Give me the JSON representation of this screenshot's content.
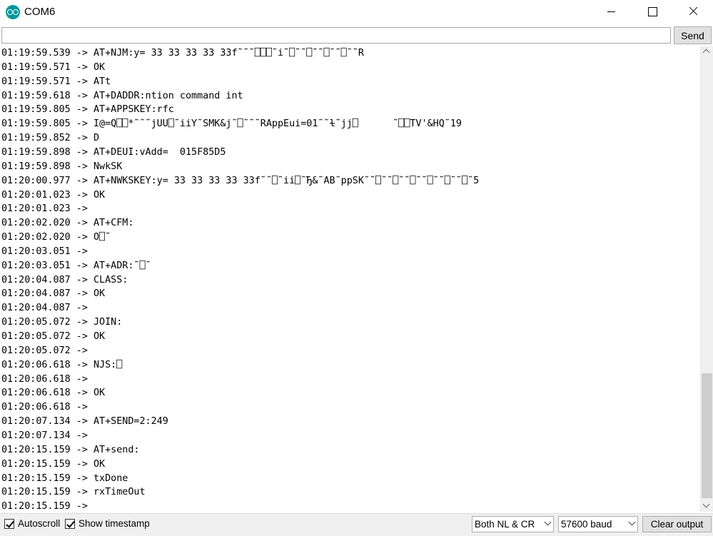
{
  "window": {
    "title": "COM6"
  },
  "toolbar": {
    "input_value": "",
    "send_label": "Send"
  },
  "output_lines": [
    "01:19:59.539 -> AT+NJM:y= 33 33 33 33 33f˜˜˜⎕⎕⎕˜i˜⎕˜˜⎕˜˜⎕˜˜⎕˜˜R",
    "01:19:59.571 -> OK",
    "01:19:59.571 -> ATt",
    "01:19:59.618 -> AT+DADDR:ntion command int",
    "01:19:59.805 -> AT+APPSKEY:rfc",
    "01:19:59.805 -> I@=Q⎕⎕*˜˜˜jUU⎕˜iiY˜SMK&j˜⎕˜˜˜RAppEui=01˜˜ɫ˜jj⎕      ˜⎕⎕TV'&HQ˜19",
    "01:19:59.852 -> D",
    "01:19:59.898 -> AT+DEUI:vAdd=  015F85D5",
    "01:19:59.898 -> NwkSK",
    "01:20:00.977 -> AT+NWKSKEY:y= 33 33 33 33 33f˜˜⎕˜ii⎕˜Ђ&˜AB˜ppSK˜˜⎕˜˜⎕˜˜⎕˜˜⎕˜˜⎕˜˜⎕˜5",
    "01:20:01.023 -> OK",
    "01:20:01.023 -> ",
    "01:20:02.020 -> AT+CFM:",
    "01:20:02.020 -> O⎕˜",
    "01:20:03.051 -> ",
    "01:20:03.051 -> AT+ADR:˜⎕˜",
    "01:20:04.087 -> CLASS:",
    "01:20:04.087 -> OK",
    "01:20:04.087 -> ",
    "01:20:05.072 -> JOIN:",
    "01:20:05.072 -> OK",
    "01:20:05.072 -> ",
    "01:20:06.618 -> NJS:⎕",
    "01:20:06.618 -> ",
    "01:20:06.618 -> OK",
    "01:20:06.618 -> ",
    "01:20:07.134 -> AT+SEND=2:249",
    "01:20:07.134 -> ",
    "01:20:15.159 -> AT+send:",
    "01:20:15.159 -> OK",
    "01:20:15.159 -> txDone",
    "01:20:15.159 -> rxTimeOut",
    "01:20:15.159 -> "
  ],
  "footer": {
    "autoscroll_label": "Autoscroll",
    "autoscroll_checked": true,
    "timestamp_label": "Show timestamp",
    "timestamp_checked": true,
    "line_ending_value": "Both NL & CR",
    "baud_value": "57600 baud",
    "clear_label": "Clear output"
  },
  "colors": {
    "app_icon": "#00979c",
    "bottom_bar": "#f0f0f0",
    "button_face": "#e1e1e1"
  },
  "icons": {
    "app": "arduino-logo-icon",
    "minimize": "minimize-icon",
    "maximize": "maximize-icon",
    "close": "close-icon"
  }
}
